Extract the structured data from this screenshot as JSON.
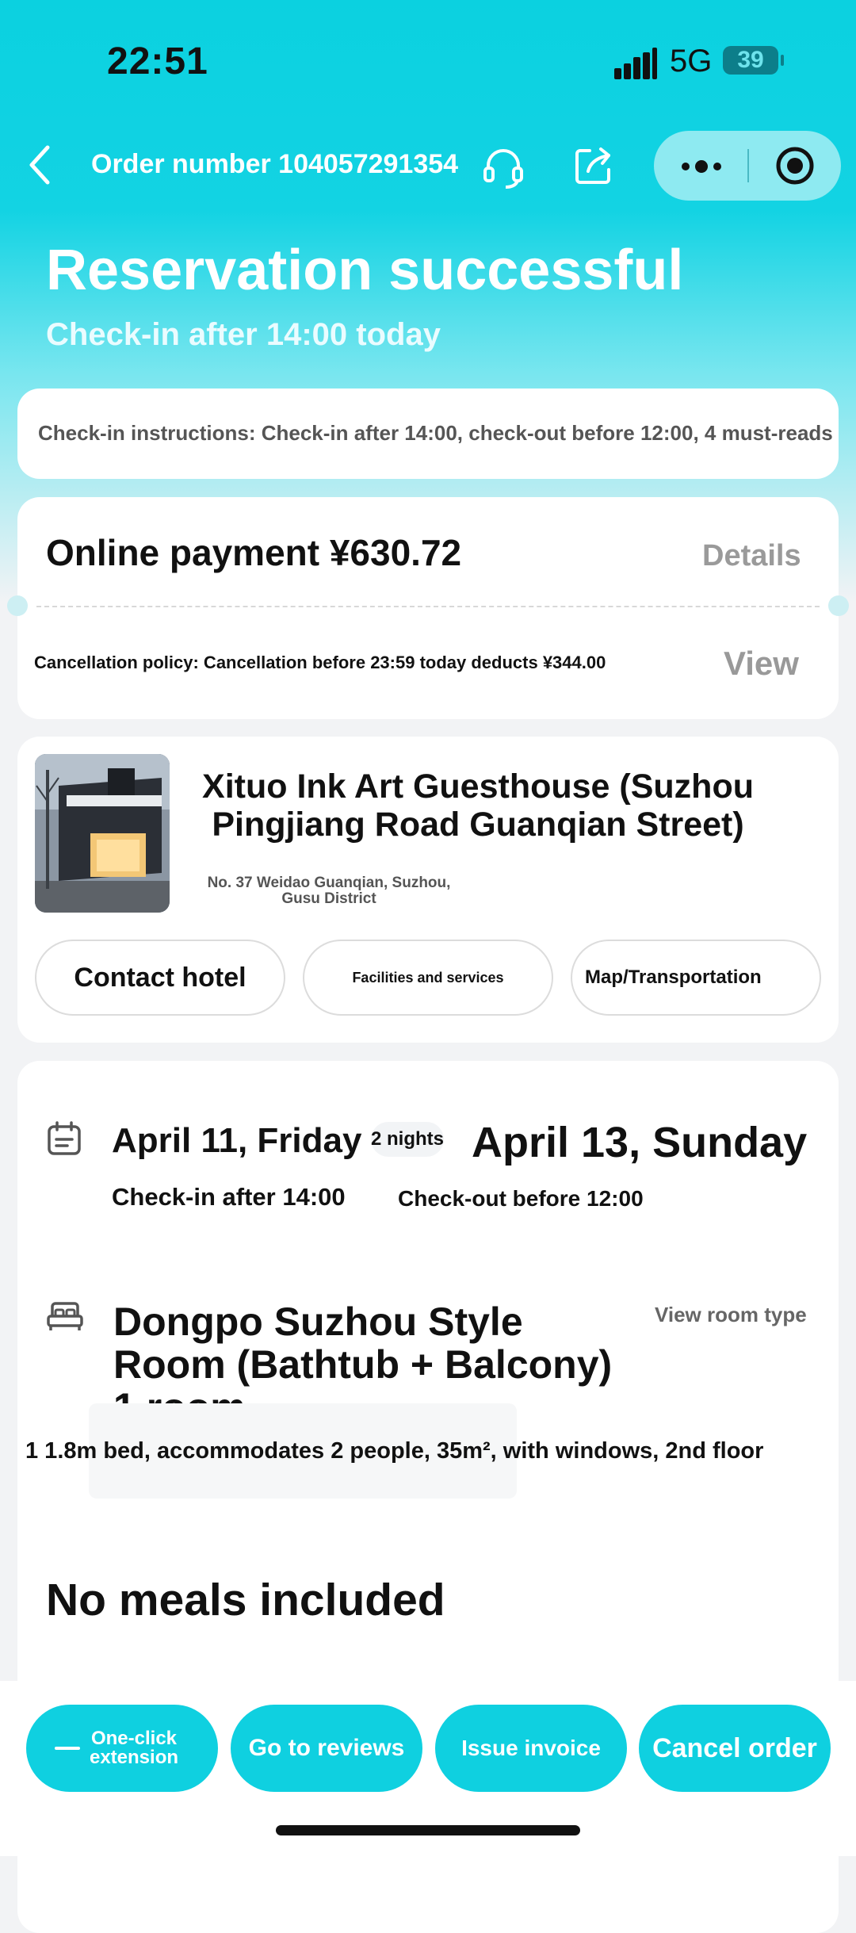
{
  "status_bar": {
    "time": "22:51",
    "network": "5G",
    "battery": "39"
  },
  "nav": {
    "order_label": "Order number 104057291354",
    "icons": {
      "back": "chevron-left-icon",
      "support": "headset-icon",
      "share": "share-icon",
      "more": "more-dots-icon",
      "close": "target-icon"
    }
  },
  "header": {
    "title": "Reservation successful",
    "subtitle": "Check-in after 14:00 today"
  },
  "notice": {
    "text": "Check-in instructions: Check-in after 14:00, check-out before 12:00, 4 must-reads"
  },
  "payment": {
    "label": "Online payment ¥630.72",
    "details": "Details",
    "cancellation": "Cancellation policy: Cancellation before 23:59 today deducts ¥344.00",
    "view": "View"
  },
  "hotel": {
    "name": "Xituo Ink Art Guesthouse (Suzhou Pingjiang Road Guanqian Street)",
    "address": "No. 37 Weidao Guanqian, Suzhou, Gusu District",
    "actions": [
      "Contact hotel",
      "Facilities and services",
      "Map/Transportation"
    ]
  },
  "stay": {
    "checkin_date": "April 11, Friday",
    "nights": "2 nights",
    "checkout_date": "April 13, Sunday",
    "checkin_time": "Check-in after 14:00",
    "checkout_time": "Check-out before 12:00"
  },
  "room": {
    "name": "Dongpo Suzhou Style Room (Bathtub + Balcony) 1 room",
    "view_link": "View room type",
    "info": "1 1.8m bed, accommodates 2 people, 35m², with windows, 2nd floor"
  },
  "meals": "No meals included",
  "bottom_actions": [
    "One-click extension",
    "Go to reviews",
    "Issue invoice",
    "Cancel order"
  ],
  "colors": {
    "accent": "#0fd0e0",
    "text": "#111111",
    "muted": "#999999"
  }
}
